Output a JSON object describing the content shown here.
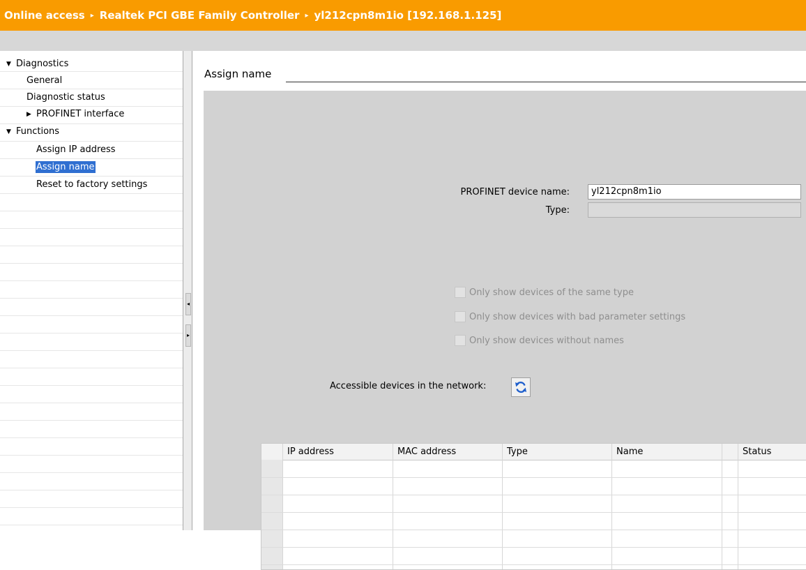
{
  "header": {
    "breadcrumb": [
      "Online access",
      "Realtek PCI GBE Family Controller",
      "yl212cpn8m1io [192.168.1.125]"
    ],
    "separator": "▸"
  },
  "nav": {
    "items": [
      {
        "label": "Diagnostics",
        "expander": "▼"
      },
      {
        "label": "General"
      },
      {
        "label": "Diagnostic status"
      },
      {
        "label": "PROFINET interface",
        "expander": "▶"
      },
      {
        "label": "Functions",
        "expander": "▼"
      },
      {
        "label": "Assign IP address"
      },
      {
        "label": "Assign name",
        "selected": true
      },
      {
        "label": "Reset to factory settings"
      }
    ]
  },
  "splitter": {
    "collapse_glyph": "◂",
    "expand_glyph": "▸"
  },
  "main": {
    "section_title": "Assign name",
    "device_name_label": "PROFINET device name:",
    "device_name_value": "yl212cpn8m1io",
    "type_label": "Type:",
    "type_value": "",
    "filters": [
      {
        "label": "Only show devices of the same type",
        "checked": false,
        "enabled": false
      },
      {
        "label": "Only show devices with bad parameter settings",
        "checked": false,
        "enabled": false
      },
      {
        "label": "Only show devices without names",
        "checked": false,
        "enabled": false
      }
    ],
    "accessible_label": "Accessible devices in the network:",
    "refresh_icon": "refresh-icon",
    "table": {
      "columns": [
        "IP address",
        "MAC address",
        "Type",
        "Name",
        "Status"
      ],
      "rows": []
    }
  },
  "colors": {
    "title_bar": "#f99b00",
    "selection": "#2f6fd1",
    "panel_gray": "#d2d2d2",
    "refresh_icon": "#1f5fcc"
  }
}
